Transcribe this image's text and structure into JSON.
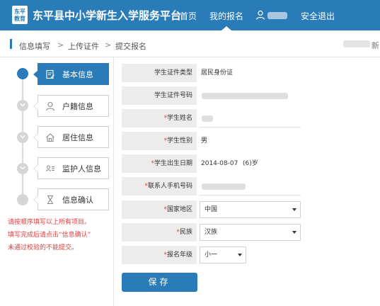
{
  "header": {
    "logo_text": "东平教育",
    "title": "东平县中小学新生入学服务平台",
    "nav_home": "首页",
    "nav_mine": "我的报名",
    "nav_logout": "安全退出",
    "brand_color": "#2a7cb8"
  },
  "breadcrumb": {
    "items": [
      "信息填写",
      "上传证件",
      "提交报名"
    ],
    "separator": ">",
    "right_text": "新"
  },
  "steps": [
    {
      "label": "基本信息",
      "icon": "form-edit-icon",
      "active": true
    },
    {
      "label": "户籍信息",
      "icon": "person-icon",
      "active": false
    },
    {
      "label": "居住信息",
      "icon": "house-icon",
      "active": false
    },
    {
      "label": "监护人信息",
      "icon": "id-card-icon",
      "active": false
    },
    {
      "label": "信息确认",
      "icon": "hourglass-icon",
      "active": false
    }
  ],
  "notes": [
    "请按顺序填写以上所有项目。",
    "填写完成后请点击“信息确认”",
    "未通过校验的不能提交。"
  ],
  "form": {
    "id_type_label": "学生证件类型",
    "id_type_value": "居民身份证",
    "id_number_label": "学生证件号码",
    "name_label": "学生姓名",
    "gender_label": "学生性别",
    "gender_value": "男",
    "birthdate_label": "学生出生日期",
    "birthdate_value": "2014-08-07",
    "age_value": "(6)岁",
    "phone_label": "联系人手机号码",
    "country_label": "国家地区",
    "country_value": "中国",
    "ethnicity_label": "民族",
    "ethnicity_value": "汉族",
    "grade_label": "报名年级",
    "grade_value": "小一",
    "required_mark": "*"
  },
  "save_label": "保存"
}
